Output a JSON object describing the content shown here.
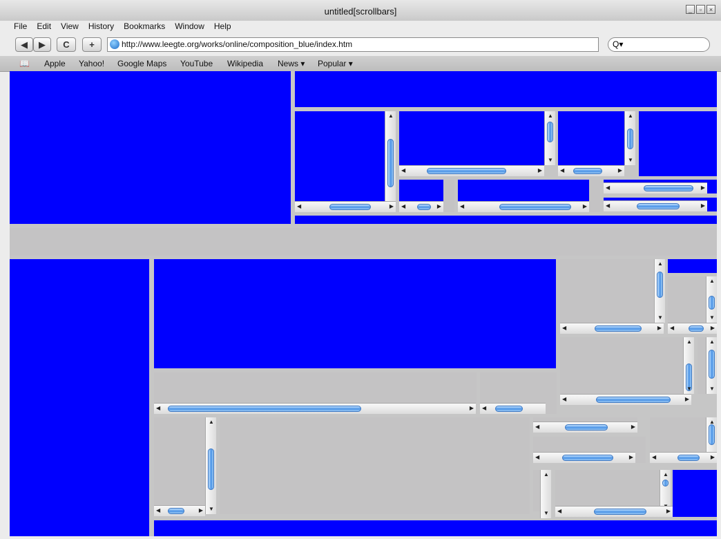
{
  "window": {
    "title": "untitled[scrollbars]"
  },
  "menus": [
    "File",
    "Edit",
    "View",
    "History",
    "Bookmarks",
    "Window",
    "Help"
  ],
  "toolbar": {
    "back_label": "◀",
    "forward_label": "▶",
    "reload_label": "C",
    "add_label": "+",
    "url": "http://www.leegte.org/works/online/composition_blue/index.htm",
    "search_icon": "Q▾"
  },
  "bookmarks": {
    "book_icon": "📖",
    "items": [
      "Apple",
      "Yahoo!",
      "Google Maps",
      "YouTube",
      "Wikipedia",
      "News ▾",
      "Popular ▾"
    ]
  },
  "colors": {
    "blue": "#0000ff",
    "gray": "#c4c3c4",
    "thumb": "#4a93e6"
  }
}
